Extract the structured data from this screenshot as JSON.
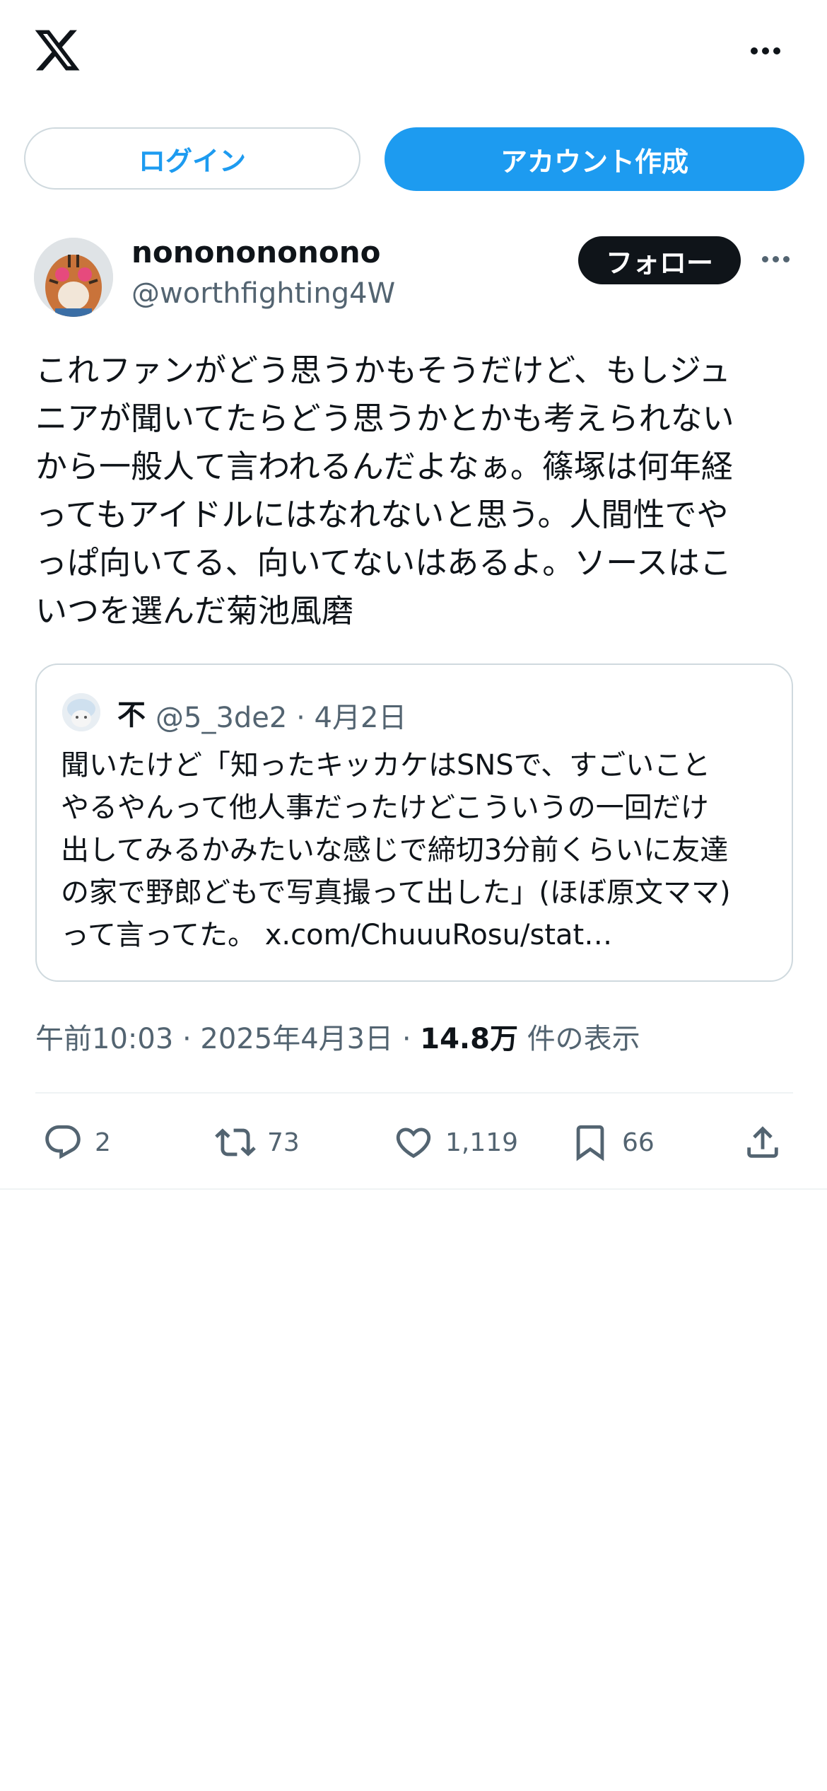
{
  "header": {
    "logo": "x-logo-icon",
    "more": "more-icon"
  },
  "auth": {
    "login_label": "ログイン",
    "signup_label": "アカウント作成"
  },
  "tweet": {
    "display_name": "nononononono",
    "handle": "@worthfighting4W",
    "follow_label": "フォロー",
    "text": "これファンがどう思うかもそうだけど、もしジュ\nニアが聞いてたらどう思うかとかも考えられない\nから一般人て言われるんだよなぁ。篠塚は何年経\nってもアイドルにはなれないと思う。人間性でや\nっぱ向いてる、向いてないはあるよ。ソースはこ\nいつを選んだ菊池風磨"
  },
  "quote": {
    "name": "不",
    "meta": "@5_3de2 · 4月2日",
    "text": "聞いたけど「知ったキッカケはSNSで、すごいこと\nやるやんって他人事だったけどこういうの一回だけ\n出してみるかみたいな感じで締切3分前くらいに友達\nの家で野郎どもで写真撮って出した」(ほぼ原文ママ)\nって言ってた。 x.com/ChuuuRosu/stat…"
  },
  "meta": {
    "timestamp": "午前10:03 · 2025年4月3日 · ",
    "views": "14.8万",
    "views_suffix": " 件の表示"
  },
  "actions": {
    "replies": "2",
    "retweets": "73",
    "likes": "1,119",
    "bookmarks": "66"
  },
  "colors": {
    "accent": "#1d9bf0",
    "text": "#0f1419",
    "muted": "#536471",
    "border": "#cfd9de"
  }
}
